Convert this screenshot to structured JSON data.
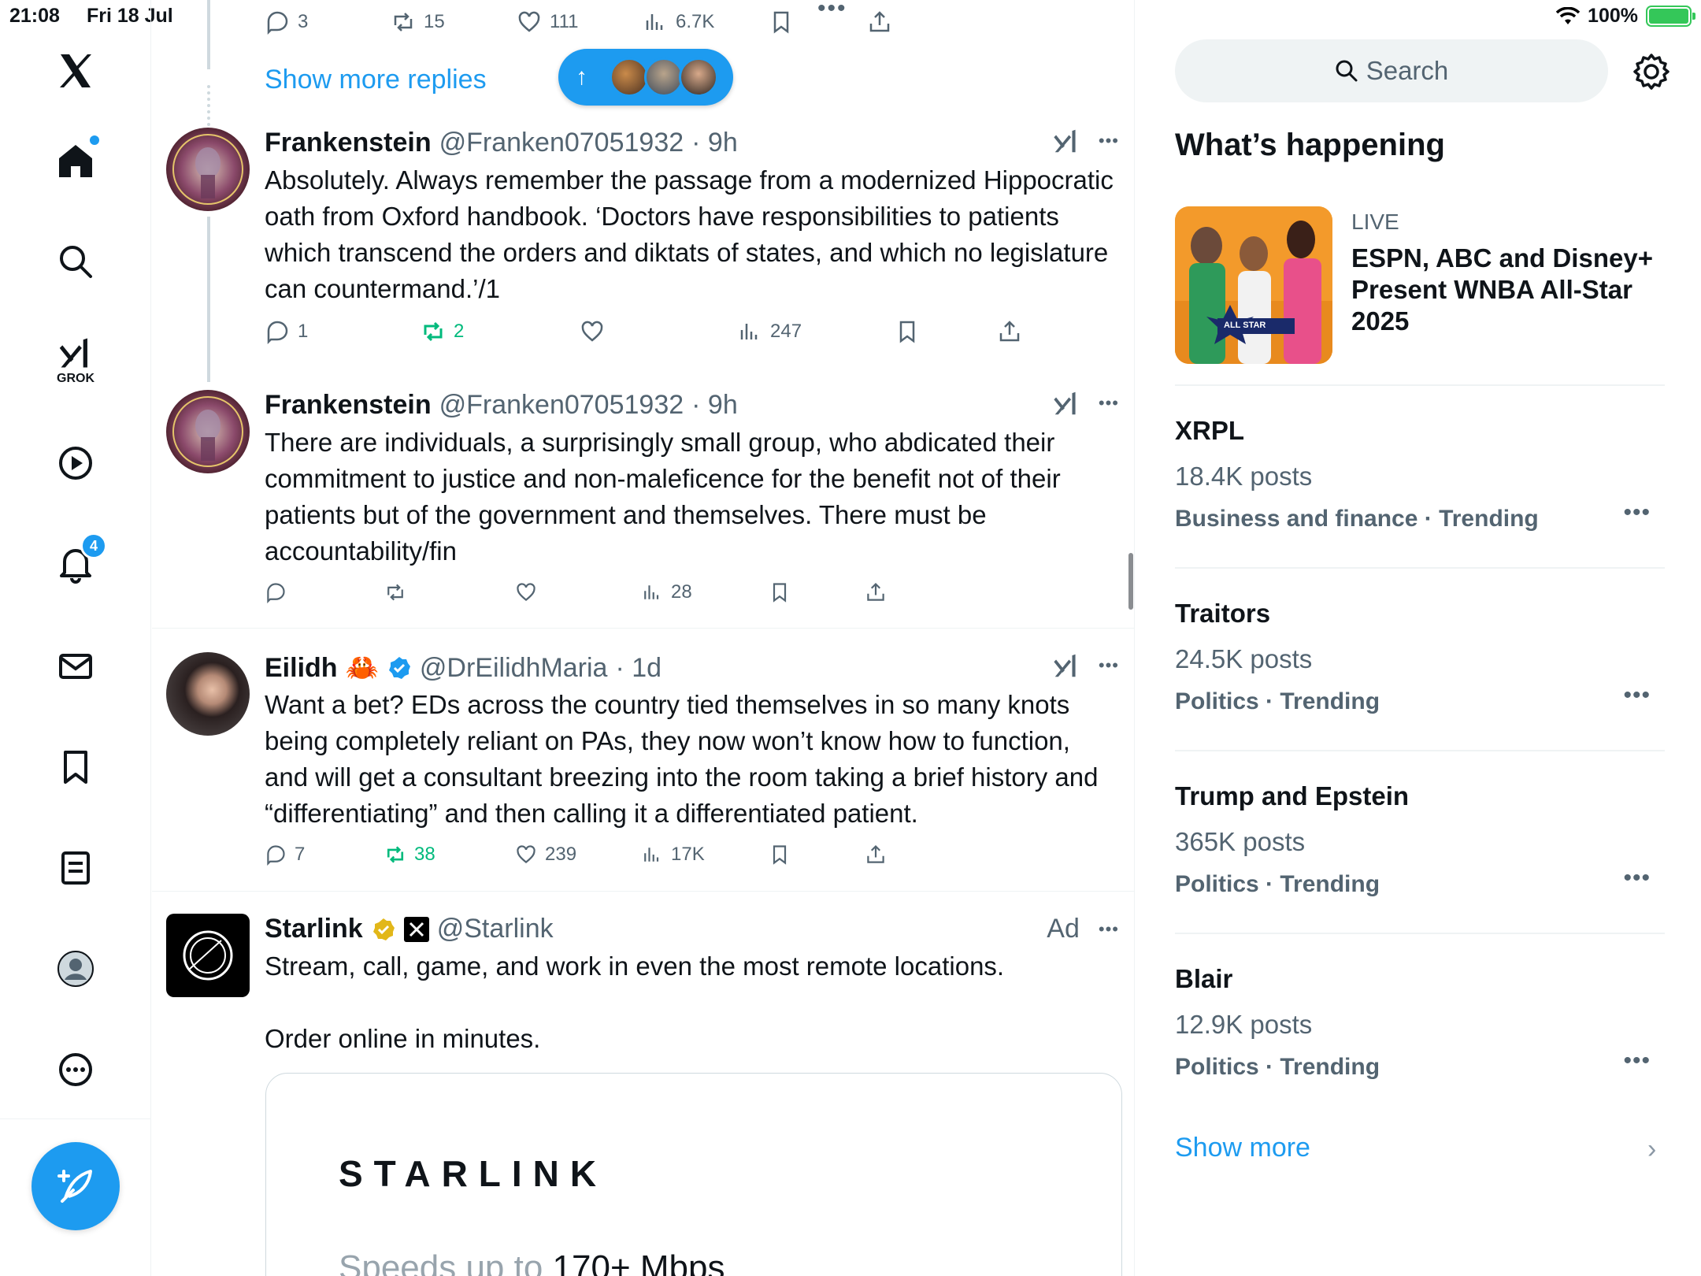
{
  "status_bar": {
    "time": "21:08",
    "date": "Fri 18 Jul",
    "battery": "100%",
    "wifi_icon": "wifi-icon",
    "battery_level": 1.0
  },
  "nav": {
    "notifications_badge": "4",
    "grok_label": "GROK",
    "items": [
      "x-logo-icon",
      "home-icon",
      "search-icon",
      "grok-icon",
      "video-icon",
      "bell-icon",
      "mail-icon",
      "bookmark-icon",
      "lists-icon",
      "profile-icon",
      "more-icon"
    ]
  },
  "feed": {
    "top_actions": {
      "replies": "3",
      "reposts": "15",
      "likes": "111",
      "views": "6.7K"
    },
    "show_more_replies": "Show more replies",
    "posts": [
      {
        "author": "Frankenstein",
        "handle": "@Franken07051932",
        "time": "· 9h",
        "text": "Absolutely. Always remember the passage from a modernized Hippocratic oath from Oxford handbook. ‘Doctors have responsibilities to patients which transcend the orders and diktats of states, and which no legislature can countermand.’/1",
        "replies": "1",
        "reposts": "2",
        "likes": "",
        "views": "247"
      },
      {
        "author": "Frankenstein",
        "handle": "@Franken07051932",
        "time": "· 9h",
        "text": "There are individuals, a surprisingly small group, who abdicated their commitment to justice and non-maleficence for the benefit not of their patients but of the government and themselves. There must be accountability/fin",
        "replies": "",
        "reposts": "",
        "likes": "",
        "views": "28"
      },
      {
        "author": "Eilidh",
        "emoji": "🦀",
        "handle": "@DrEilidhMaria",
        "time": "· 1d",
        "text": "Want a bet? EDs across the country tied themselves in so many knots being completely reliant on PAs, they now won’t know how to function, and will get a consultant breezing into the room taking a brief history and “differentiating” and then calling it a differentiated patient.",
        "replies": "7",
        "reposts": "38",
        "likes": "239",
        "views": "17K"
      },
      {
        "author": "Starlink",
        "handle": "@Starlink",
        "ad_label": "Ad",
        "text_line1": "Stream, call, game, and work in even the most remote locations.",
        "text_line2": "Order online in minutes.",
        "card_brand": "STARLINK",
        "card_speed_light": "Speeds up to ",
        "card_speed_dark": "170+ Mbps"
      }
    ]
  },
  "sidebar": {
    "search_placeholder": "Search",
    "whats_happening": "What’s happening",
    "live": {
      "label": "LIVE",
      "title": "ESPN, ABC and Disney+ Present WNBA All-Star 2025",
      "image_badge": "ALL STAR"
    },
    "trends": [
      {
        "name": "XRPL",
        "posts": "18.4K posts",
        "meta": "Business and finance · Trending"
      },
      {
        "name": "Traitors",
        "posts": "24.5K posts",
        "meta": "Politics · Trending"
      },
      {
        "name": "Trump and Epstein",
        "posts": "365K posts",
        "meta": "Politics · Trending"
      },
      {
        "name": "Blair",
        "posts": "12.9K posts",
        "meta": "Politics · Trending"
      }
    ],
    "show_more": "Show more"
  },
  "colors": {
    "accent": "#1d9bf0",
    "repost_green": "#00ba7c",
    "muted": "#536471"
  }
}
